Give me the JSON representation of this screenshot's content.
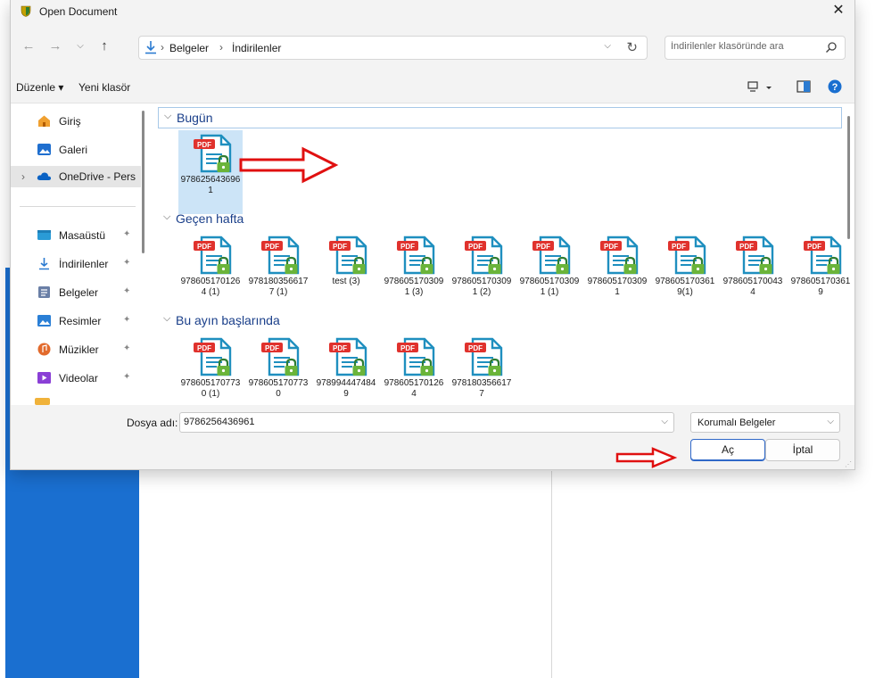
{
  "window": {
    "title": "Open Document",
    "close_label": "✕"
  },
  "nav": {
    "back": "←",
    "forward": "→",
    "recent": "⌵",
    "up": "↑"
  },
  "address": {
    "crumbs": [
      "Belgeler",
      "İndirilenler"
    ],
    "separator": "›",
    "dropdown": "⌵",
    "refresh": "↻"
  },
  "search": {
    "placeholder": "İndirilenler klasöründe ara"
  },
  "toolbar": {
    "organize_label": "Düzenle ▾",
    "new_folder_label": "Yeni klasör"
  },
  "sidebar": {
    "items": [
      {
        "label": "Giriş",
        "icon": "home-icon"
      },
      {
        "label": "Galeri",
        "icon": "gallery-icon"
      },
      {
        "label": "OneDrive - Pers",
        "icon": "cloud-icon"
      },
      {
        "label": "Masaüstü",
        "icon": "desktop-icon"
      },
      {
        "label": "İndirilenler",
        "icon": "download-icon"
      },
      {
        "label": "Belgeler",
        "icon": "documents-icon"
      },
      {
        "label": "Resimler",
        "icon": "pictures-icon"
      },
      {
        "label": "Müzikler",
        "icon": "music-icon"
      },
      {
        "label": "Videolar",
        "icon": "videos-icon"
      }
    ],
    "expand_glyph": "›",
    "pin_glyph": "📌"
  },
  "groups": [
    {
      "label": "Bugün",
      "files": [
        {
          "name": "9786256436961"
        }
      ]
    },
    {
      "label": "Geçen hafta",
      "files": [
        {
          "name": "9786051701264 (1)"
        },
        {
          "name": "9781803566177 (1)"
        },
        {
          "name": "test (3)"
        },
        {
          "name": "9786051703091 (3)"
        },
        {
          "name": "9786051703091 (2)"
        },
        {
          "name": "9786051703091 (1)"
        },
        {
          "name": "9786051703091"
        },
        {
          "name": "9786051703619(1)"
        },
        {
          "name": "9786051700434"
        },
        {
          "name": "9786051703619"
        }
      ]
    },
    {
      "label": "Bu ayın başlarında",
      "files": [
        {
          "name": "9786051707730 (1)"
        },
        {
          "name": "9786051707730"
        },
        {
          "name": "9789944474849"
        },
        {
          "name": "9786051701264"
        },
        {
          "name": "9781803566177"
        }
      ]
    }
  ],
  "footer": {
    "file_name_label": "Dosya adı:",
    "file_name_value": "9786256436961",
    "file_type_value": "Korumalı Belgeler",
    "open_label": "Aç",
    "cancel_label": "İptal"
  },
  "colors": {
    "accent": "#1a6fd0",
    "selection": "#cce4f7",
    "annotation_red": "#e01010",
    "group_text": "#1a3f8a"
  }
}
